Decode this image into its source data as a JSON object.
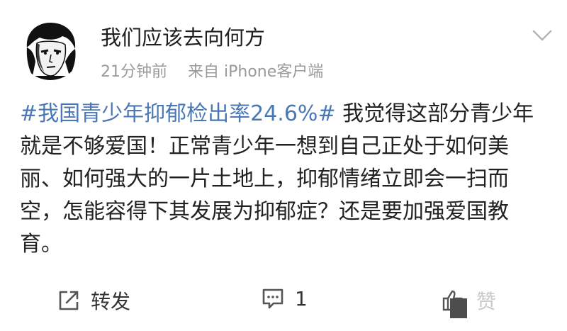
{
  "header": {
    "username": "我们应该去向何方",
    "time": "21分钟前",
    "source": "来自 iPhone客户端"
  },
  "post": {
    "hashtag": "#我国青少年抑郁检出率24.6%#",
    "body": " 我觉得这部分青少年就是不够爱国！正常青少年一想到自己正处于如何美丽、如何强大的一片土地上，抑郁情绪立即会一扫而空，怎能容得下其发展为抑郁症？还是要加强爱国教育。"
  },
  "actions": {
    "repost": {
      "icon": "repost-icon",
      "label": "转发"
    },
    "comment": {
      "icon": "comment-icon",
      "label": "1"
    },
    "like": {
      "icon": "thumbs-up-icon",
      "label": "赞"
    }
  },
  "colors": {
    "hashtag": "#4a78b5",
    "meta": "#9a9a9a",
    "text": "#222222"
  }
}
